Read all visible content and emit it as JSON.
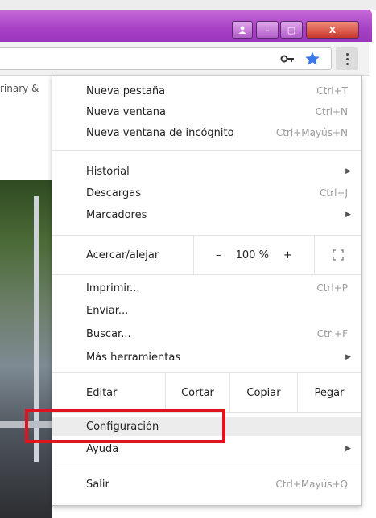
{
  "window": {
    "buttons": {
      "minimize": "–",
      "maximize": "▢",
      "close": "X"
    },
    "accent_color": "#a640c4"
  },
  "toolbar": {
    "icons": [
      "key-icon",
      "star-icon",
      "more-vert-icon"
    ],
    "star_color": "#3b78e7"
  },
  "page": {
    "tab_text": "rinary &"
  },
  "menu": {
    "group1": [
      {
        "label": "Nueva pestaña",
        "shortcut": "Ctrl+T"
      },
      {
        "label": "Nueva ventana",
        "shortcut": "Ctrl+N"
      },
      {
        "label": "Nueva ventana de incógnito",
        "shortcut": "Ctrl+Mayús+N"
      }
    ],
    "group2": [
      {
        "label": "Historial",
        "shortcut": ""
      },
      {
        "label": "Descargas",
        "shortcut": "Ctrl+J"
      },
      {
        "label": "Marcadores",
        "shortcut": ""
      }
    ],
    "zoom": {
      "label": "Acercar/alejar",
      "minus": "–",
      "value": "100 %",
      "plus": "+"
    },
    "group3": [
      {
        "label": "Imprimir...",
        "shortcut": "Ctrl+P"
      },
      {
        "label": "Enviar...",
        "shortcut": ""
      },
      {
        "label": "Buscar...",
        "shortcut": "Ctrl+F"
      },
      {
        "label": "Más herramientas",
        "shortcut": ""
      }
    ],
    "edit": {
      "label": "Editar",
      "cut": "Cortar",
      "copy": "Copiar",
      "paste": "Pegar"
    },
    "group4": [
      {
        "label": "Configuración",
        "shortcut": ""
      },
      {
        "label": "Ayuda",
        "shortcut": ""
      }
    ],
    "exit": {
      "label": "Salir",
      "shortcut": "Ctrl+Mayús+Q"
    }
  },
  "highlight_color": "#e0141e"
}
